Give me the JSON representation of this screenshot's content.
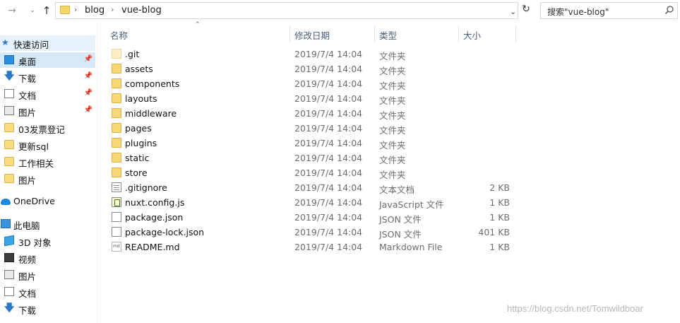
{
  "address": {
    "breadcrumbs": [
      "blog",
      "vue-blog"
    ]
  },
  "search": {
    "placeholder": "搜索\"vue-blog\""
  },
  "sidebar": {
    "quick_access": "快速访问",
    "items": [
      {
        "label": "桌面",
        "icon": "desktop-icon",
        "pinned": true
      },
      {
        "label": "下载",
        "icon": "download-icon",
        "pinned": true
      },
      {
        "label": "文档",
        "icon": "document-icon",
        "pinned": true
      },
      {
        "label": "图片",
        "icon": "picture-icon",
        "pinned": true
      },
      {
        "label": "03发票登记",
        "icon": "folder-icon",
        "pinned": false
      },
      {
        "label": "更新sql",
        "icon": "folder-icon",
        "pinned": false
      },
      {
        "label": "工作相关",
        "icon": "folder-icon",
        "pinned": false
      },
      {
        "label": "图片",
        "icon": "folder-icon",
        "pinned": false
      }
    ],
    "onedrive": "OneDrive",
    "this_pc": "此电脑",
    "pc_items": [
      {
        "label": "3D 对象",
        "icon": "3d-objects-icon"
      },
      {
        "label": "视频",
        "icon": "video-icon"
      },
      {
        "label": "图片",
        "icon": "picture-icon"
      },
      {
        "label": "文档",
        "icon": "document-icon"
      },
      {
        "label": "下载",
        "icon": "download-icon"
      }
    ]
  },
  "columns": {
    "name": "名称",
    "date": "修改日期",
    "type": "类型",
    "size": "大小"
  },
  "files": [
    {
      "name": ".git",
      "date": "2019/7/4 14:04",
      "type": "文件夹",
      "size": "",
      "icon": "hidden-folder-icon"
    },
    {
      "name": "assets",
      "date": "2019/7/4 14:04",
      "type": "文件夹",
      "size": "",
      "icon": "folder-icon"
    },
    {
      "name": "components",
      "date": "2019/7/4 14:04",
      "type": "文件夹",
      "size": "",
      "icon": "folder-icon"
    },
    {
      "name": "layouts",
      "date": "2019/7/4 14:04",
      "type": "文件夹",
      "size": "",
      "icon": "folder-icon"
    },
    {
      "name": "middleware",
      "date": "2019/7/4 14:04",
      "type": "文件夹",
      "size": "",
      "icon": "folder-icon"
    },
    {
      "name": "pages",
      "date": "2019/7/4 14:04",
      "type": "文件夹",
      "size": "",
      "icon": "folder-icon"
    },
    {
      "name": "plugins",
      "date": "2019/7/4 14:04",
      "type": "文件夹",
      "size": "",
      "icon": "folder-icon"
    },
    {
      "name": "static",
      "date": "2019/7/4 14:04",
      "type": "文件夹",
      "size": "",
      "icon": "folder-icon"
    },
    {
      "name": "store",
      "date": "2019/7/4 14:04",
      "type": "文件夹",
      "size": "",
      "icon": "folder-icon"
    },
    {
      "name": ".gitignore",
      "date": "2019/7/4 14:04",
      "type": "文本文档",
      "size": "2 KB",
      "icon": "text-file-icon"
    },
    {
      "name": "nuxt.config.js",
      "date": "2019/7/4 14:04",
      "type": "JavaScript 文件",
      "size": "1 KB",
      "icon": "js-file-icon"
    },
    {
      "name": "package.json",
      "date": "2019/7/4 14:04",
      "type": "JSON 文件",
      "size": "1 KB",
      "icon": "file-icon"
    },
    {
      "name": "package-lock.json",
      "date": "2019/7/4 14:04",
      "type": "JSON 文件",
      "size": "401 KB",
      "icon": "file-icon"
    },
    {
      "name": "README.md",
      "date": "2019/7/4 14:04",
      "type": "Markdown File",
      "size": "1 KB",
      "icon": "markdown-file-icon"
    }
  ],
  "watermark": "https://blog.csdn.net/Tomwildboar"
}
